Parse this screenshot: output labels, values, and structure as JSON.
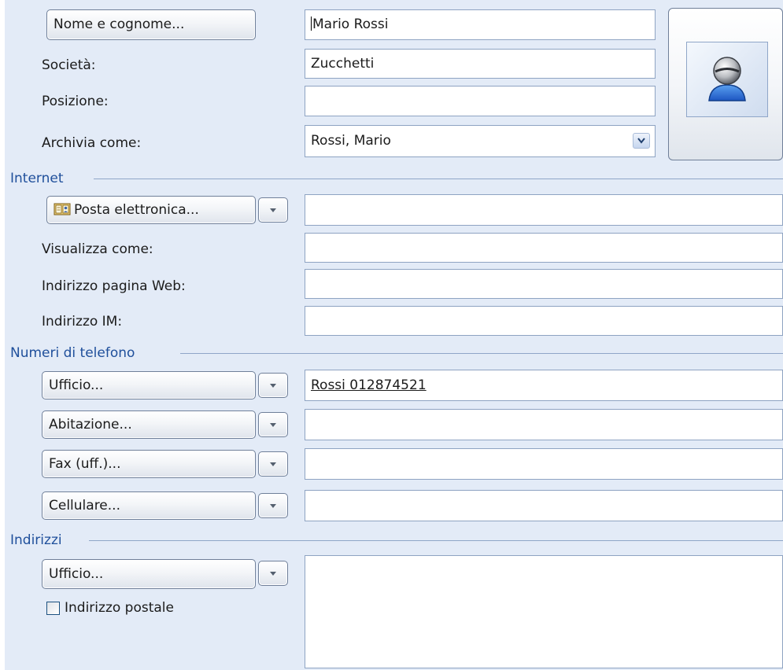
{
  "name": {
    "button_label": "Nome e cognome...",
    "value": "Mario Rossi"
  },
  "company": {
    "label": "Società:",
    "value": "Zucchetti"
  },
  "position": {
    "label": "Posizione:",
    "value": ""
  },
  "file_as": {
    "label": "Archivia come:",
    "value": "Rossi, Mario"
  },
  "contact_photo": {
    "icon": "contact-person-icon"
  },
  "internet": {
    "section_title": "Internet",
    "email_button_label": "Posta elettronica...",
    "email_icon": "address-book-icon",
    "email_value": "",
    "display_as_label": "Visualizza come:",
    "display_as_value": "",
    "web_page_label": "Indirizzo pagina Web:",
    "web_page_value": "",
    "im_label": "Indirizzo IM:",
    "im_value": ""
  },
  "phones": {
    "section_title": "Numeri di telefono",
    "items": [
      {
        "button_label": "Ufficio...",
        "value": "Rossi 012874521"
      },
      {
        "button_label": "Abitazione...",
        "value": ""
      },
      {
        "button_label": "Fax (uff.)...",
        "value": ""
      },
      {
        "button_label": "Cellulare...",
        "value": ""
      }
    ]
  },
  "addresses": {
    "section_title": "Indirizzi",
    "button_label": "Ufficio...",
    "mailing_checkbox_label": "Indirizzo postale",
    "mailing_checked": false,
    "value": ""
  },
  "colors": {
    "panel_background": "#e3ebf7",
    "section_title": "#1f4f9b",
    "field_border": "#8ea3c2"
  }
}
